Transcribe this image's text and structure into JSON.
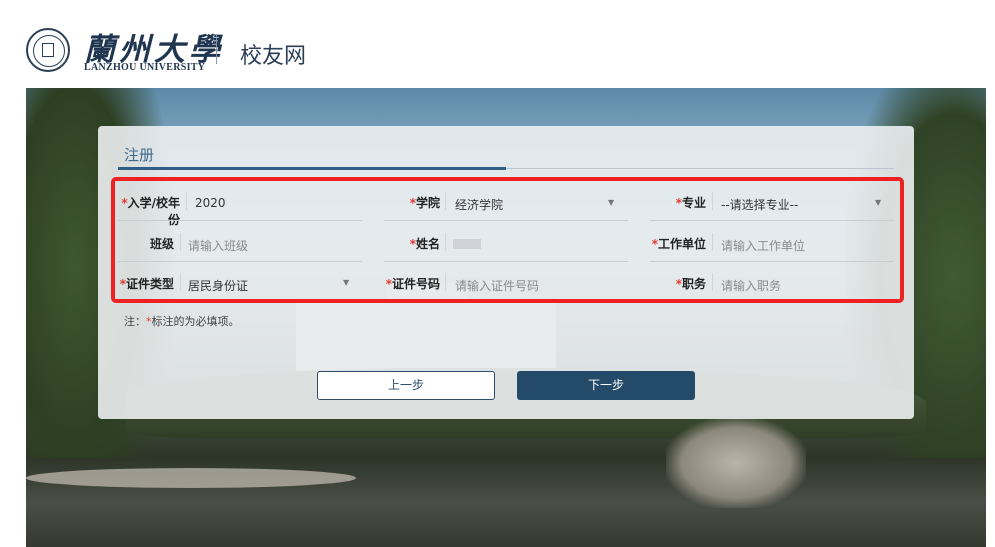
{
  "header": {
    "logo_cn": "蘭州大學",
    "logo_en": "LANZHOU UNIVERSITY",
    "site_name": "校友网"
  },
  "panel": {
    "tab_label": "注册",
    "required_mark": "*",
    "fields": {
      "enroll_year": {
        "label": "入学/校年份",
        "value": "2020",
        "required": true
      },
      "college": {
        "label": "学院",
        "value": "经济学院",
        "required": true
      },
      "major": {
        "label": "专业",
        "value": "--请选择专业--",
        "required": true
      },
      "class": {
        "label": "班级",
        "placeholder": "请输入班级",
        "required": false
      },
      "name": {
        "label": "姓名",
        "required": true
      },
      "work_unit": {
        "label": "工作单位",
        "placeholder": "请输入工作单位",
        "required": true
      },
      "id_type": {
        "label": "证件类型",
        "value": "居民身份证",
        "required": true
      },
      "id_number": {
        "label": "证件号码",
        "placeholder": "请输入证件号码",
        "required": true
      },
      "position": {
        "label": "职务",
        "placeholder": "请输入职务",
        "required": true
      }
    },
    "note_prefix": "注：",
    "note_suffix": "标注的为必填项。",
    "prev_button": "上一步",
    "next_button": "下一步"
  },
  "colors": {
    "brand": "#244a6a",
    "required": "#e23c2f",
    "highlight": "#ee2222"
  }
}
